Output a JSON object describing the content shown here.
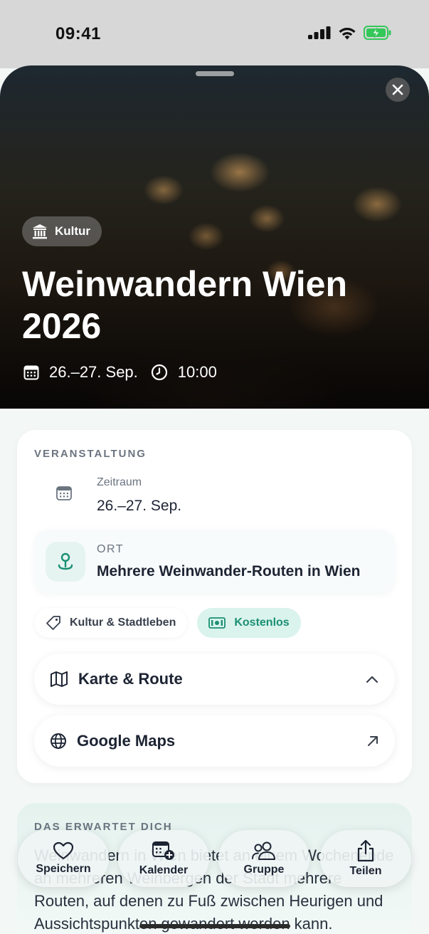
{
  "status_bar": {
    "time": "09:41"
  },
  "hero": {
    "category": "Kultur",
    "title": "Weinwandern Wien 2026",
    "date": "26.–27. Sep.",
    "time": "10:00"
  },
  "event": {
    "section_label": "VERANSTALTUNG",
    "zeitraum_label": "Zeitraum",
    "zeitraum_value": "26.–27. Sep.",
    "ort_label": "ORT",
    "ort_value": "Mehrere Weinwander-Routen in Wien",
    "tags": [
      "Kultur & Stadtleben",
      "Kostenlos"
    ],
    "map_route_label": "Karte & Route",
    "google_maps_label": "Google Maps"
  },
  "expect": {
    "section_label": "DAS ERWARTET DICH",
    "body": "Weinwandern in Wien bietet an einem Wochenende an mehreren Weinbergen der Stadt mehrere Routen, auf denen zu Fuß zwischen Heurigen und Aussichtspunkten gewandert werden kann."
  },
  "dock": {
    "save": "Speichern",
    "calendar": "Kalender",
    "group": "Gruppe",
    "share": "Teilen"
  },
  "colors": {
    "accent": "#1a8f74",
    "accent_bg": "#daf3ec",
    "text": "#1d2433"
  },
  "icons": [
    "close-icon",
    "museum-icon",
    "calendar-icon",
    "clock-icon",
    "location-pin-icon",
    "tag-icon",
    "cash-icon",
    "map-icon",
    "chevron-up-icon",
    "globe-icon",
    "arrow-up-right-icon",
    "heart-icon",
    "calendar-add-icon",
    "group-icon",
    "share-icon"
  ]
}
